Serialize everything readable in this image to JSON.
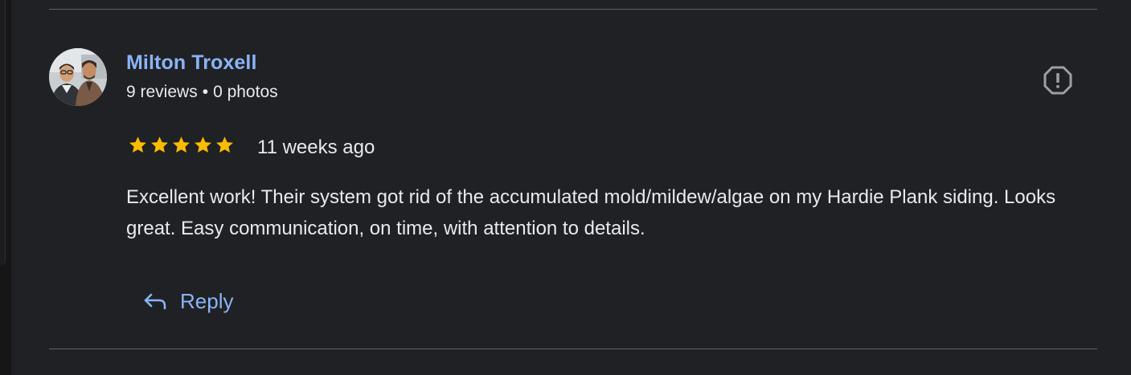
{
  "review": {
    "reviewer": {
      "name": "Milton Troxell",
      "reviews_count": "9 reviews",
      "separator": "•",
      "photos_count": "0 photos",
      "avatar_icon": "avatar-photo"
    },
    "rating": {
      "value": 5,
      "max": 5,
      "star_color": "#fbbc04"
    },
    "date": "11 weeks ago",
    "text": "Excellent work! Their system got rid of the accumulated mold/mildew/algae on my Hardie Plank siding. Looks great. Easy communication, on time, with attention to details.",
    "actions": {
      "reply_label": "Reply",
      "reply_icon": "reply-arrow-icon",
      "flag_icon": "report-octagon-icon"
    }
  },
  "colors": {
    "background": "#202124",
    "link": "#8ab4f8",
    "text": "#e8eaed",
    "divider": "#5f6368"
  }
}
